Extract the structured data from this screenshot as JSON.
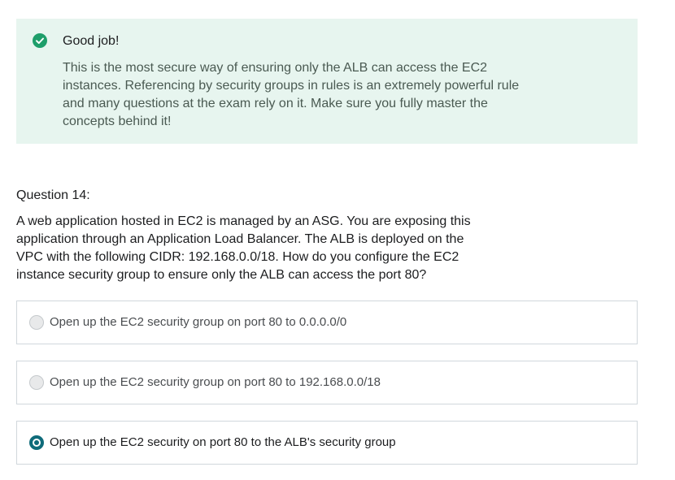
{
  "feedback": {
    "status_icon": "check-circle-icon",
    "title": "Good job!",
    "body": "This is the most secure way of ensuring only the ALB can access the EC2 instances. Referencing by security groups in rules is an extremely powerful rule and many questions at the exam rely on it. Make sure you fully master the concepts behind it!",
    "accent_color": "#1e9e6a",
    "background_color": "#e7f5ef"
  },
  "question": {
    "title": "Question 14:",
    "text": "A web application hosted in EC2 is managed by an ASG. You are exposing this application through an Application Load Balancer. The ALB is deployed on the VPC with the following CIDR: 192.168.0.0/18. How do you configure the EC2 instance security group to ensure only the ALB can access the port 80?"
  },
  "options": [
    {
      "label": "Open up the EC2 security group on port 80 to 0.0.0.0/0",
      "selected": false
    },
    {
      "label": "Open up the EC2 security group on port 80 to 192.168.0.0/18",
      "selected": false
    },
    {
      "label": "Open up the EC2 security on port 80 to the ALB's security group",
      "selected": true
    }
  ],
  "selected_color": "#0f6b7a"
}
